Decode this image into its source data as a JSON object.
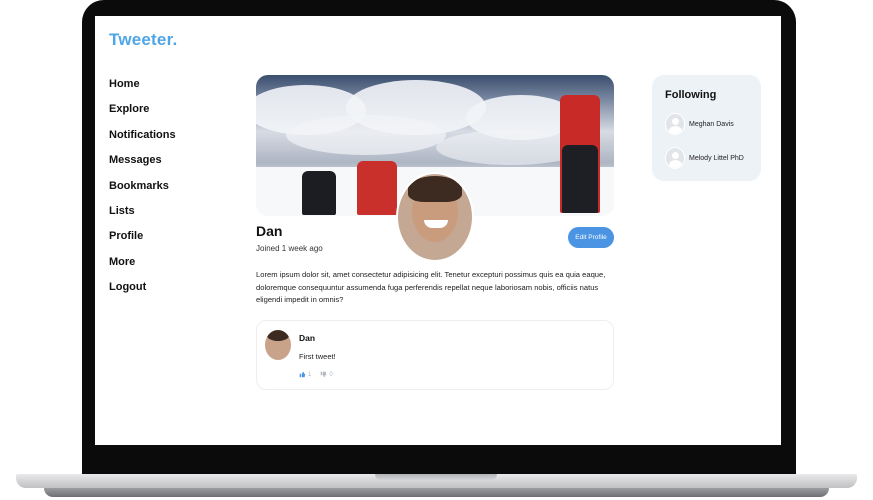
{
  "app": {
    "logo": "Tweeter."
  },
  "nav": {
    "items": [
      "Home",
      "Explore",
      "Notifications",
      "Messages",
      "Bookmarks",
      "Lists",
      "Profile",
      "More",
      "Logout"
    ]
  },
  "profile": {
    "name": "Dan",
    "joined": "Joined 1 week ago",
    "edit_label": "Edit Profile",
    "bio": "Lorem ipsum dolor sit, amet consectetur adipisicing elit. Tenetur excepturi possimus quis ea quia eaque, doloremque consequuntur assumenda fuga perferendis repellat neque laboriosam nobis, officiis natus eligendi impedit in omnis?"
  },
  "tweet": {
    "author": "Dan",
    "text": "First tweet!",
    "likes": "1",
    "dislikes": "0"
  },
  "following": {
    "title": "Following",
    "users": [
      "Meghan Davis",
      "Melody Littel PhD"
    ]
  },
  "colors": {
    "brand": "#4fa6e6",
    "button": "#4a94e3",
    "panel": "#edf2f7"
  },
  "icons": {
    "like": "thumbs-up-icon",
    "dislike": "thumbs-down-icon",
    "avatar_placeholder": "user-placeholder-icon"
  }
}
